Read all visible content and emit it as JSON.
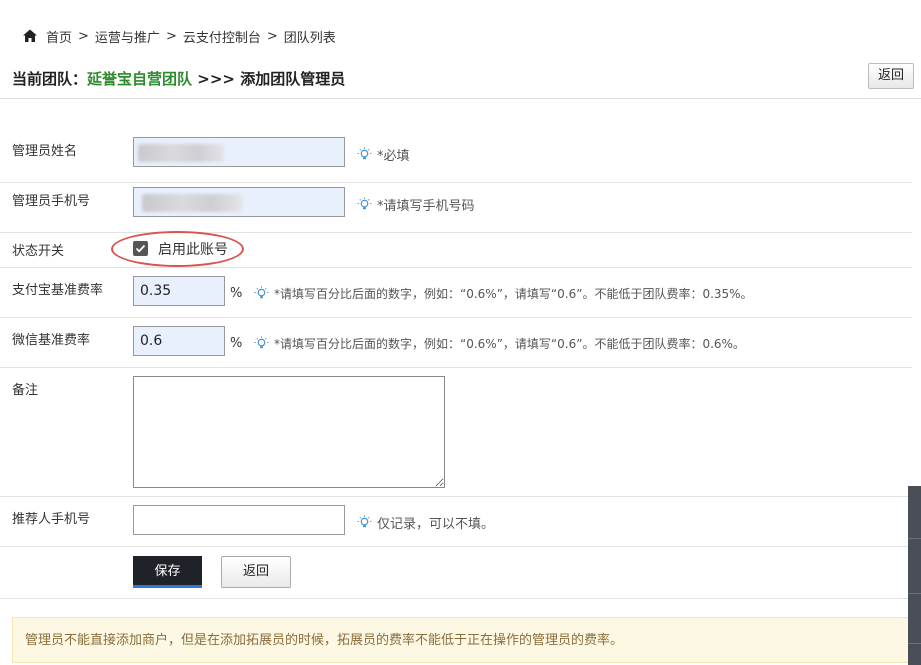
{
  "breadcrumb": {
    "items": [
      "首页",
      "运营与推广",
      "云支付控制台",
      "团队列表"
    ],
    "separator": ">"
  },
  "header": {
    "prefix": "当前团队：",
    "team_name": "延誉宝自营团队",
    "arrows": " >>> ",
    "page_title": "添加团队管理员",
    "back_label": "返回"
  },
  "form": {
    "name": {
      "label": "管理员姓名",
      "hint": "*必填"
    },
    "phone": {
      "label": "管理员手机号",
      "hint": "*请填写手机号码"
    },
    "status": {
      "label": "状态开关",
      "checkbox_label": "启用此账号",
      "checked": true
    },
    "alipay_rate": {
      "label": "支付宝基准费率",
      "value": "0.35",
      "unit": "%",
      "hint": "*请填写百分比后面的数字，例如：“0.6%”，请填写“0.6”。不能低于团队费率：0.35%。"
    },
    "wechat_rate": {
      "label": "微信基准费率",
      "value": "0.6",
      "unit": "%",
      "hint": "*请填写百分比后面的数字，例如：“0.6%”，请填写“0.6”。不能低于团队费率：0.6%。"
    },
    "remark": {
      "label": "备注",
      "value": ""
    },
    "referrer_phone": {
      "label": "推荐人手机号",
      "value": "",
      "hint": "仅记录，可以不填。"
    }
  },
  "actions": {
    "save_label": "保存",
    "back_label": "返回"
  },
  "notice": "管理员不能直接添加商户，但是在添加拓展员的时候，拓展员的费率不能低于正在操作的管理员的费率。",
  "colors": {
    "team_name": "#2e8b2e",
    "input_autofill": "#e8f0fe",
    "save_button": "#1f2329",
    "highlight_oval": "#d9534f",
    "notice_bg": "#fdf8e4",
    "notice_text": "#8a6d3b"
  },
  "icons": {
    "home": "home-icon",
    "hint": "lightbulb-icon"
  }
}
